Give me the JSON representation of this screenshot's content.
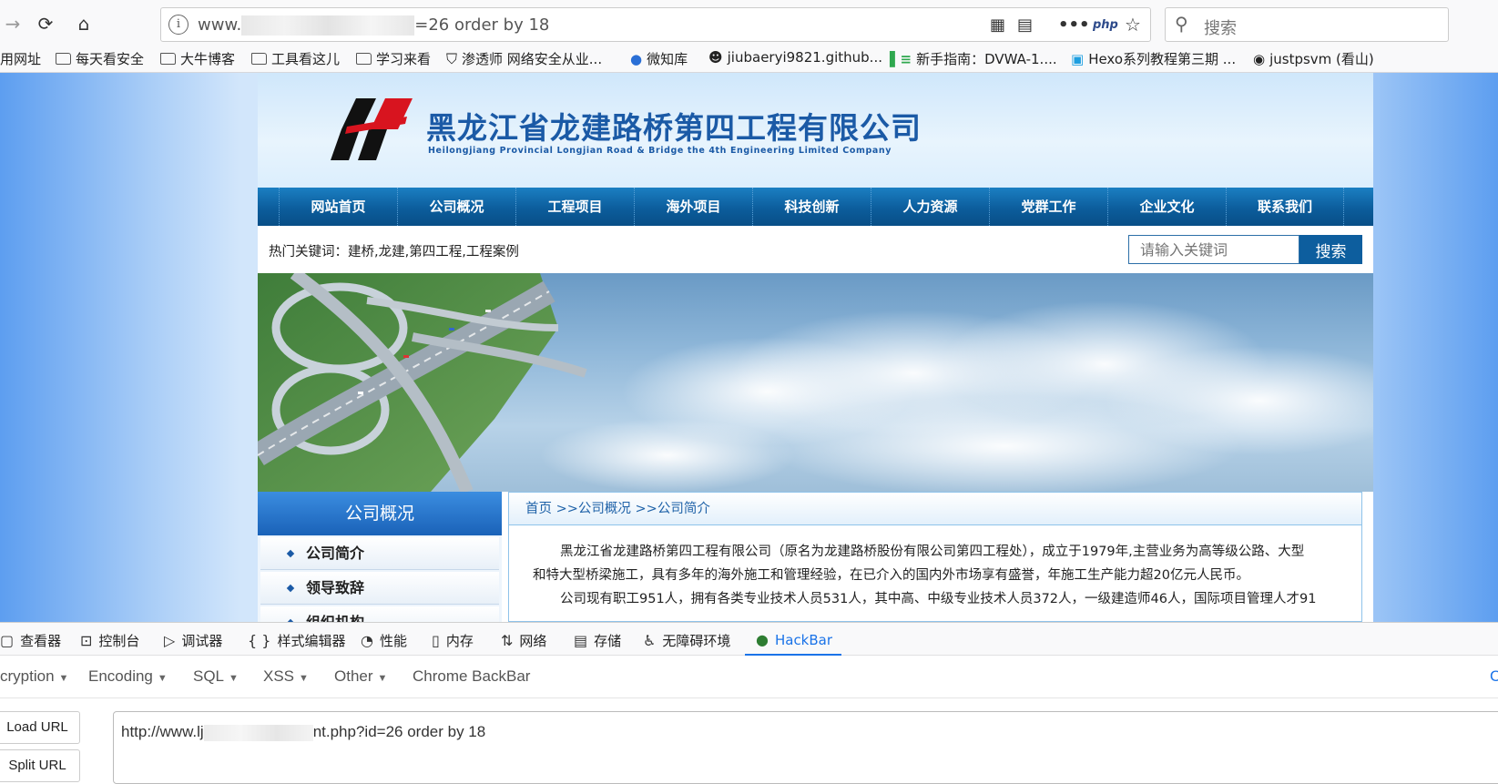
{
  "browser": {
    "url_visible_start": "www.",
    "url_visible_end": "=26 order by 18",
    "search_placeholder": "搜索",
    "php_badge": "php",
    "bookmarks": [
      "用网址",
      "每天看安全",
      "大牛博客",
      "工具看这儿",
      "学习来看",
      "渗透师 网络安全从业...",
      "微知库",
      "jiubaeryi9821.github...",
      "新手指南：DVWA-1....",
      "Hexo系列教程第三期 ...",
      "justpsvm (看山)"
    ]
  },
  "site": {
    "company_name": "黑龙江省龙建路桥第四工程有限公司",
    "company_name_en": "Heilongjiang Provincial Longjian Road & Bridge the 4th Engineering Limited Company",
    "nav": [
      "网站首页",
      "公司概况",
      "工程项目",
      "海外项目",
      "科技创新",
      "人力资源",
      "党群工作",
      "企业文化",
      "联系我们"
    ],
    "hot_keywords": "热门关键词：建桥,龙建,第四工程,工程案例",
    "search_placeholder": "请输入关键词",
    "search_button": "搜索",
    "sidebar": {
      "title": "公司概况",
      "items": [
        "公司简介",
        "领导致辞",
        "组织机构"
      ]
    },
    "breadcrumb": "首页 >>公司概况 >>公司简介",
    "paragraph_line1": "黑龙江省龙建路桥第四工程有限公司（原名为龙建路桥股份有限公司第四工程处），成立于1979年,主营业务为高等级公路、大型",
    "paragraph_line2": "和特大型桥梁施工，具有多年的海外施工和管理经验，在已介入的国内外市场享有盛誉，年施工生产能力超20亿元人民币。",
    "paragraph_line3": "公司现有职工951人，拥有各类专业技术人员531人，其中高、中级专业技术人员372人，一级建造师46人，国际项目管理人才91"
  },
  "devtools": {
    "tabs": [
      "查看器",
      "控制台",
      "调试器",
      "样式编辑器",
      "性能",
      "内存",
      "网络",
      "存储",
      "无障碍环境",
      "HackBar"
    ],
    "hackbar_menu": [
      "cryption",
      "Encoding",
      "SQL",
      "XSS",
      "Other",
      "Chrome BackBar"
    ],
    "load_url": "Load URL",
    "split_url": "Split URL",
    "url_start": "http://www.lj",
    "url_end": "nt.php?id=26 order by 18"
  },
  "colors": {
    "nav_bg": "#0c5d9c",
    "brand_blue": "#1b5aa6",
    "hackbar_accent": "#1a73e8"
  }
}
